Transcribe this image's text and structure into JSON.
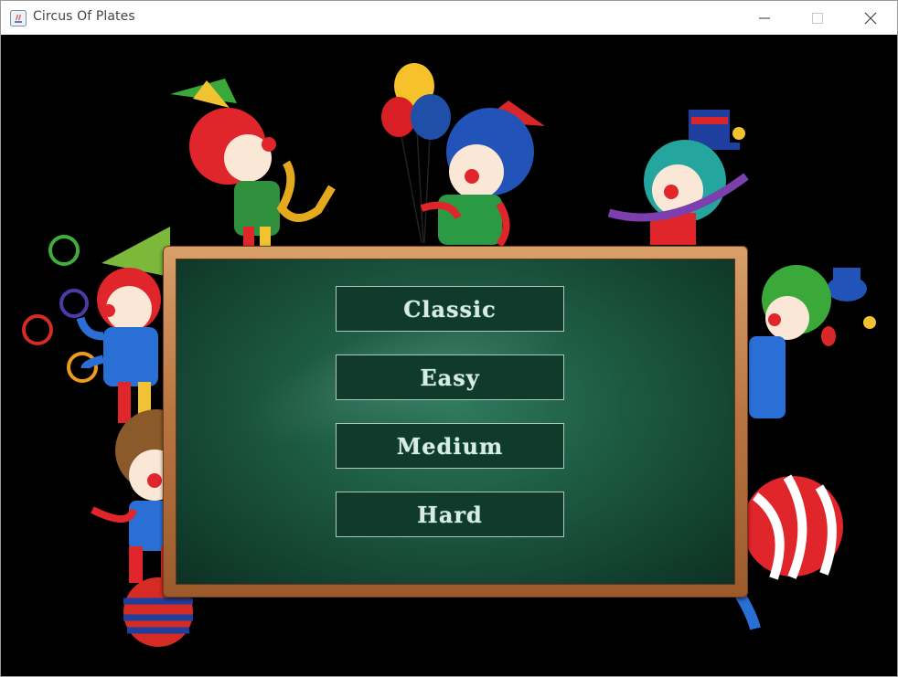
{
  "window": {
    "title": "Circus Of Plates",
    "controls": {
      "minimize_icon": "minimize-icon",
      "maximize_icon": "maximize-icon",
      "close_icon": "close-icon"
    }
  },
  "menu": {
    "buttons": [
      {
        "id": "classic",
        "label": "Classic"
      },
      {
        "id": "easy",
        "label": "Easy"
      },
      {
        "id": "medium",
        "label": "Medium"
      },
      {
        "id": "hard",
        "label": "Hard"
      }
    ]
  },
  "colors": {
    "background": "#000000",
    "board_green": "#1e5c44",
    "board_frame": "#b8733f",
    "button_bg": "#0f3a2c",
    "button_border": "#aec9bd",
    "button_text": "#d7ece2"
  }
}
